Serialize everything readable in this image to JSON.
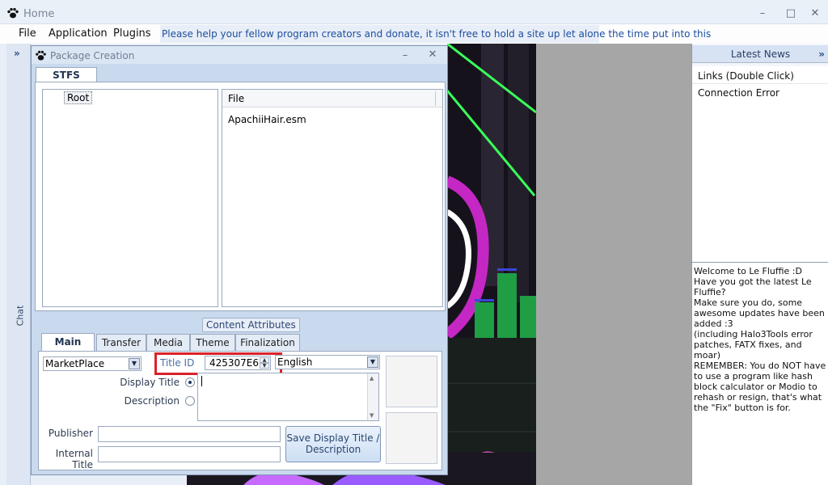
{
  "window": {
    "title": "Home",
    "minimize": "–",
    "maximize": "□",
    "close": "✕"
  },
  "menu": {
    "items": [
      "File",
      "Application",
      "Plugins"
    ],
    "donate_text": "Please help your fellow program creators and donate, it isn't free to hold a site up let alone the time put into this"
  },
  "chat": {
    "expand": "»",
    "label": "Chat"
  },
  "news": {
    "header": "Latest News",
    "expand": "»",
    "items": [
      "Links (Double Click)",
      "Connection Error"
    ],
    "message": "Welcome to Le Fluffie :D\nHave you got the latest Le Fluffie?\nMake sure you do, some awesome updates have been added :3\n(including Halo3Tools error patches, FATX fixes, and moar)\nREMEMBER: You do NOT have to use a program like hash block calculator or Modio to rehash or resign, that's what the \"Fix\" button is for."
  },
  "dialog": {
    "title": "Package Creation",
    "minimize": "–",
    "close": "✕",
    "tab": "STFS",
    "tree_root": "Root",
    "file_header": "File",
    "files": [
      "ApachiiHair.esm"
    ],
    "group_label": "Content Attributes",
    "inner_tabs": [
      "Main",
      "Transfer",
      "Media",
      "Theme",
      "Finalization"
    ],
    "package_type": "MarketPlace",
    "title_id_label": "Title ID",
    "title_id_value": "425307E6",
    "language": "English",
    "display_title_label": "Display Title",
    "description_label": "Description",
    "publisher_label": "Publisher",
    "internal_title_label": "Internal Title",
    "save_button": "Save Display Title / Description"
  },
  "colors": {
    "accent": "#1d4fa0",
    "highlight_box": "#d9222a",
    "window_bg": "#e8eef7"
  }
}
